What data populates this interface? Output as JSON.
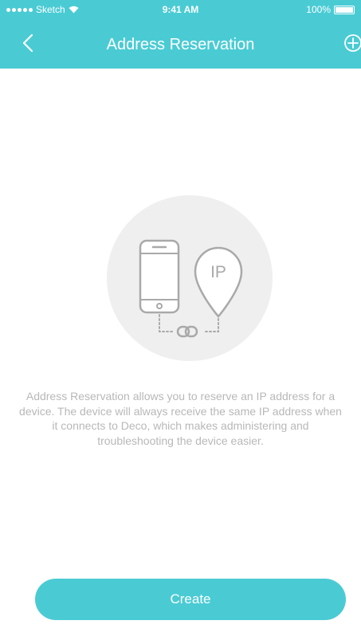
{
  "status_bar": {
    "carrier": "Sketch",
    "time": "9:41 AM",
    "battery": "100%",
    "battery_level": 1.0
  },
  "nav": {
    "title": "Address Reservation",
    "back_icon": "chevron-left-icon",
    "add_icon": "plus-circle-icon"
  },
  "illustration": {
    "ip_label": "IP"
  },
  "description": "Address Reservation allows you to reserve an IP address for a device. The device will always receive the same IP address when it connects to Deco, which makes administering and troubleshooting the device easier.",
  "create_button": {
    "label": "Create"
  },
  "colors": {
    "accent": "#4ACBD4",
    "illustration_bg": "#EFEFEF",
    "illustration_stroke": "#A9A9A9",
    "text_muted": "#B8B8B8"
  }
}
